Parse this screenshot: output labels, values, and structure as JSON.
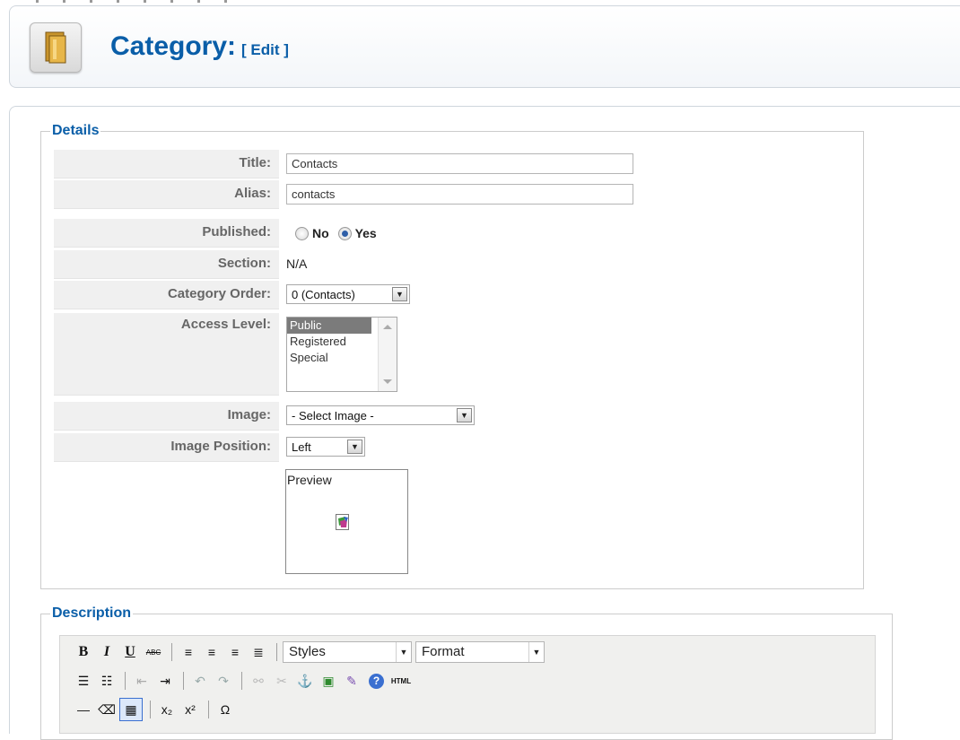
{
  "header": {
    "title": "Category:",
    "edit_label": "[ Edit ]"
  },
  "details": {
    "legend": "Details",
    "fields": {
      "title": {
        "label": "Title:",
        "value": "Contacts"
      },
      "alias": {
        "label": "Alias:",
        "value": "contacts"
      },
      "published": {
        "label": "Published:",
        "options": [
          "No",
          "Yes"
        ],
        "selected": "Yes"
      },
      "section": {
        "label": "Section:",
        "value": "N/A"
      },
      "category_order": {
        "label": "Category Order:",
        "value": "0 (Contacts)"
      },
      "access_level": {
        "label": "Access Level:",
        "options": [
          "Public",
          "Registered",
          "Special"
        ],
        "selected": "Public"
      },
      "image": {
        "label": "Image:",
        "value": "- Select Image -"
      },
      "image_position": {
        "label": "Image Position:",
        "value": "Left"
      }
    },
    "preview_label": "Preview"
  },
  "description": {
    "legend": "Description",
    "styles_label": "Styles",
    "format_label": "Format",
    "html_label": "HTML"
  },
  "colors": {
    "accent": "#0a5ea8",
    "label_bg": "#f0f0f0",
    "selected_option_bg": "#7b7b7b"
  }
}
